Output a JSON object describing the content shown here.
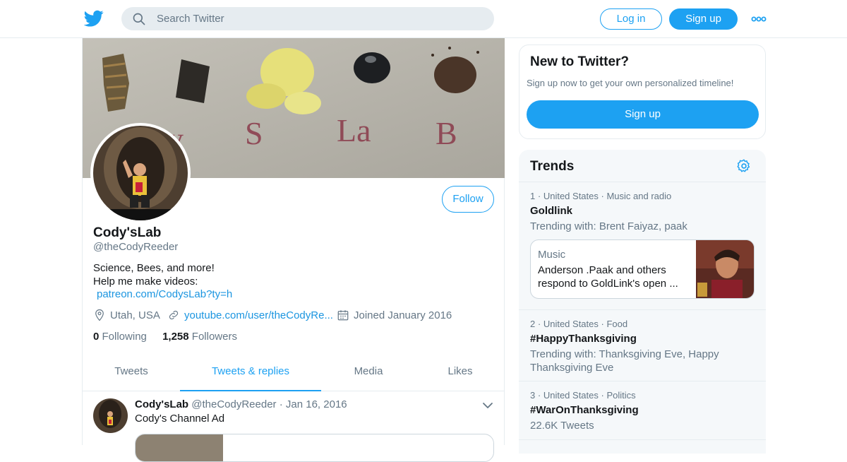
{
  "topbar": {
    "search_placeholder": "Search Twitter",
    "login_label": "Log in",
    "signup_label": "Sign up",
    "brand_color": "#1da1f2",
    "logo_icon": "twitter-bird-icon",
    "more_icon": "more-dots-icon"
  },
  "profile": {
    "banner_text": "C o dy  S  La  B",
    "follow_label": "Follow",
    "name": "Cody'sLab",
    "handle": "@theCodyReeder",
    "bio_line1": "Science, Bees, and more!",
    "bio_line2": "Help me make videos:",
    "bio_link": "patreon.com/CodysLab?ty=h",
    "location": "Utah, USA",
    "website": "youtube.com/user/theCodyRe...",
    "joined": "Joined January 2016",
    "following_count": "0",
    "following_label": "Following",
    "followers_count": "1,258",
    "followers_label": "Followers"
  },
  "tabs": [
    {
      "label": "Tweets",
      "active": false
    },
    {
      "label": "Tweets & replies",
      "active": true
    },
    {
      "label": "Media",
      "active": false
    },
    {
      "label": "Likes",
      "active": false
    }
  ],
  "tweet": {
    "author": "Cody'sLab",
    "handle": "@theCodyReeder",
    "separator": "·",
    "date": "Jan 16, 2016",
    "text": "Cody's Channel Ad"
  },
  "new_to_twitter": {
    "title": "New to Twitter?",
    "subtitle": "Sign up now to get your own personalized timeline!",
    "button_label": "Sign up"
  },
  "trends": {
    "title": "Trends",
    "items": [
      {
        "rank": "1",
        "location": "United States",
        "category": "Music and radio",
        "name": "Goldlink",
        "sub": "Trending with: Brent Faiyaz, paak"
      },
      {
        "rank": "2",
        "location": "United States",
        "category": "Food",
        "name": "#HappyThanksgiving",
        "sub": "Trending with: Thanksgiving Eve, Happy Thanksgiving Eve"
      },
      {
        "rank": "3",
        "location": "United States",
        "category": "Politics",
        "name": "#WarOnThanksgiving",
        "sub": "22.6K Tweets"
      }
    ],
    "card": {
      "category": "Music",
      "text": "Anderson .Paak and others respond to GoldLink's open ..."
    },
    "dot": "·"
  }
}
